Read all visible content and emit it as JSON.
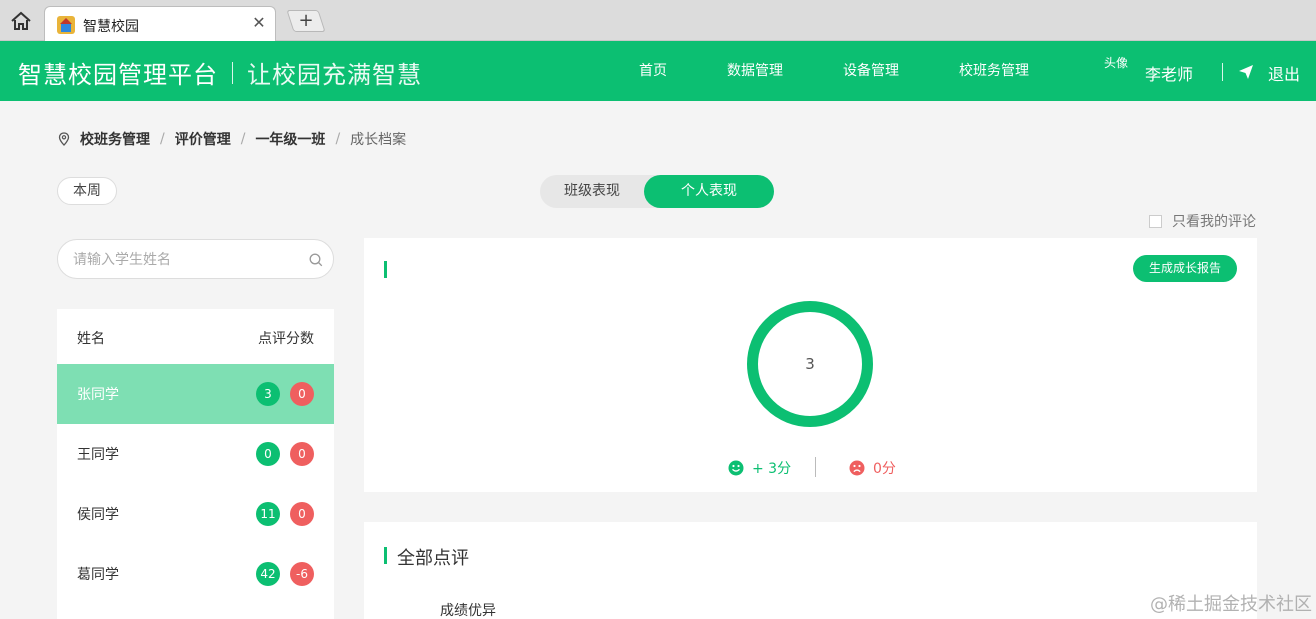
{
  "browser": {
    "tab_title": "智慧校园",
    "close_glyph": "✕",
    "newtab_glyph": "+"
  },
  "header": {
    "brand": "智慧校园管理平台",
    "slogan": "让校园充满智慧",
    "nav": [
      {
        "label": "首页"
      },
      {
        "label": "数据管理"
      },
      {
        "label": "设备管理"
      },
      {
        "label": "校班务管理"
      }
    ],
    "avatar_alt": "头像",
    "teacher": "李老师",
    "logout": "退出",
    "color": "#0cbf72"
  },
  "breadcrumb": {
    "items": [
      "校班务管理",
      "评价管理",
      "一年级一班"
    ],
    "current": "成长档案",
    "separator": "/"
  },
  "week_filter": "本周",
  "toggle": {
    "class_label": "班级表现",
    "personal_label": "个人表现",
    "selected": "个人表现"
  },
  "only_mine": "只看我的评论",
  "search": {
    "placeholder": "请输入学生姓名"
  },
  "student_list": {
    "col_name": "姓名",
    "col_score": "点评分数",
    "rows": [
      {
        "name": "张同学",
        "plus": "3",
        "minus": "0",
        "active": true
      },
      {
        "name": "王同学",
        "plus": "0",
        "minus": "0",
        "active": false
      },
      {
        "name": "侯同学",
        "plus": "11",
        "minus": "0",
        "active": false
      },
      {
        "name": "葛同学",
        "plus": "42",
        "minus": "-6",
        "active": false
      }
    ]
  },
  "stats": {
    "report_button": "生成成长报告",
    "ring_value": "3",
    "plus_text": "+ 3分",
    "minus_text": "0分",
    "pos_color": "#0cbf72",
    "neg_color": "#ef5f5f"
  },
  "comments": {
    "title": "全部点评",
    "first_category": "成绩优异"
  },
  "watermark": "@稀土掘金技术社区"
}
